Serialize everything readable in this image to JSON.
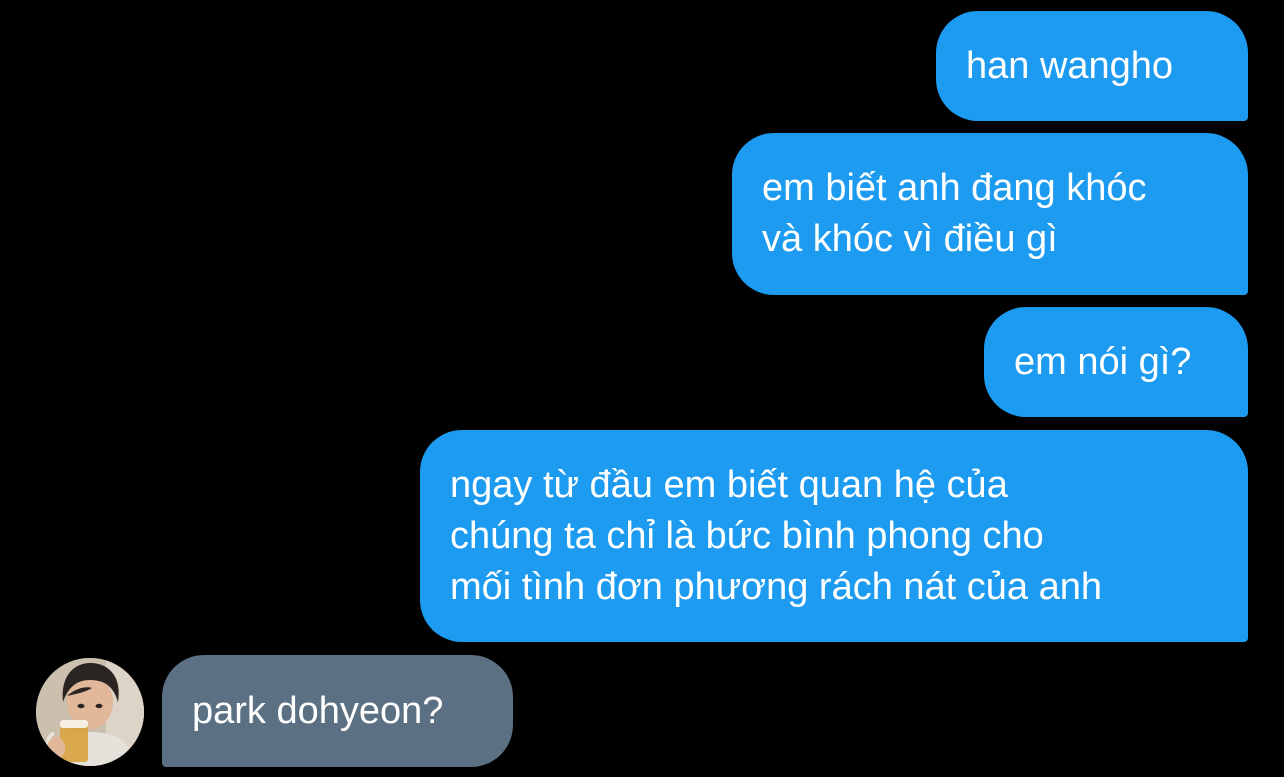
{
  "messages": [
    {
      "direction": "sent",
      "text": "han wangho"
    },
    {
      "direction": "sent",
      "text": "em biết anh đang khóc\nvà khóc vì điều gì"
    },
    {
      "direction": "sent",
      "text": "em nói gì?"
    },
    {
      "direction": "sent",
      "text": "ngay từ đầu em biết quan hệ của\nchúng ta chỉ là bức bình phong cho\nmối tình đơn phương rách nát của anh"
    },
    {
      "direction": "received",
      "text": "park dohyeon?"
    }
  ],
  "colors": {
    "background": "#000000",
    "sent_bubble": "#1d9bf0",
    "received_bubble": "#5b7083",
    "text": "#ffffff"
  },
  "avatar": {
    "icon": "user-avatar-photo"
  }
}
